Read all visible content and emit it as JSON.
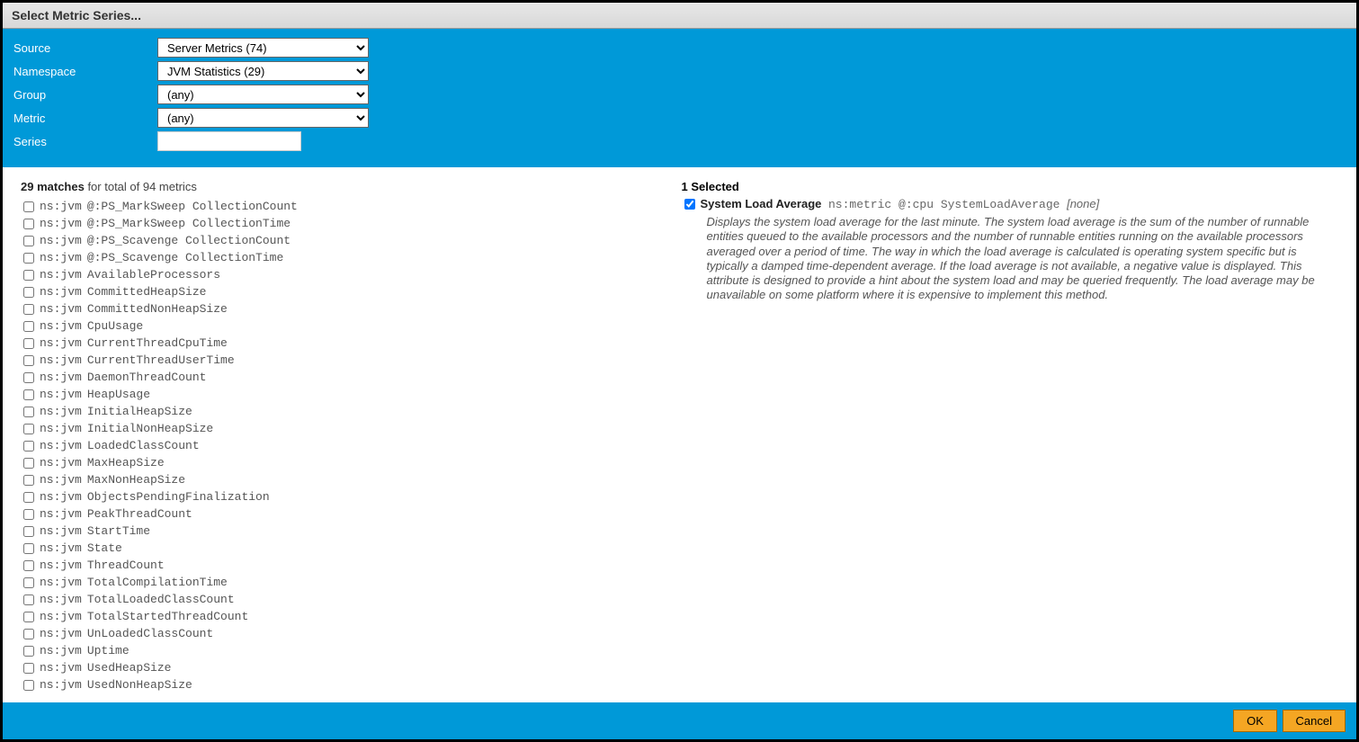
{
  "title": "Select Metric Series...",
  "form": {
    "source": {
      "label": "Source",
      "value": "Server Metrics (74)"
    },
    "namespace": {
      "label": "Namespace",
      "value": "JVM Statistics (29)"
    },
    "group": {
      "label": "Group",
      "value": "(any)"
    },
    "metric": {
      "label": "Metric",
      "value": "(any)"
    },
    "series": {
      "label": "Series",
      "value": ""
    }
  },
  "matches": {
    "count_text": "29 matches",
    "total_text": " for total of 94 metrics",
    "items": [
      {
        "ns": "ns:jvm",
        "name": "@:PS_MarkSweep CollectionCount"
      },
      {
        "ns": "ns:jvm",
        "name": "@:PS_MarkSweep CollectionTime"
      },
      {
        "ns": "ns:jvm",
        "name": "@:PS_Scavenge CollectionCount"
      },
      {
        "ns": "ns:jvm",
        "name": "@:PS_Scavenge CollectionTime"
      },
      {
        "ns": "ns:jvm",
        "name": "AvailableProcessors"
      },
      {
        "ns": "ns:jvm",
        "name": "CommittedHeapSize"
      },
      {
        "ns": "ns:jvm",
        "name": "CommittedNonHeapSize"
      },
      {
        "ns": "ns:jvm",
        "name": "CpuUsage"
      },
      {
        "ns": "ns:jvm",
        "name": "CurrentThreadCpuTime"
      },
      {
        "ns": "ns:jvm",
        "name": "CurrentThreadUserTime"
      },
      {
        "ns": "ns:jvm",
        "name": "DaemonThreadCount"
      },
      {
        "ns": "ns:jvm",
        "name": "HeapUsage"
      },
      {
        "ns": "ns:jvm",
        "name": "InitialHeapSize"
      },
      {
        "ns": "ns:jvm",
        "name": "InitialNonHeapSize"
      },
      {
        "ns": "ns:jvm",
        "name": "LoadedClassCount"
      },
      {
        "ns": "ns:jvm",
        "name": "MaxHeapSize"
      },
      {
        "ns": "ns:jvm",
        "name": "MaxNonHeapSize"
      },
      {
        "ns": "ns:jvm",
        "name": "ObjectsPendingFinalization"
      },
      {
        "ns": "ns:jvm",
        "name": "PeakThreadCount"
      },
      {
        "ns": "ns:jvm",
        "name": "StartTime"
      },
      {
        "ns": "ns:jvm",
        "name": "State"
      },
      {
        "ns": "ns:jvm",
        "name": "ThreadCount"
      },
      {
        "ns": "ns:jvm",
        "name": "TotalCompilationTime"
      },
      {
        "ns": "ns:jvm",
        "name": "TotalLoadedClassCount"
      },
      {
        "ns": "ns:jvm",
        "name": "TotalStartedThreadCount"
      },
      {
        "ns": "ns:jvm",
        "name": "UnLoadedClassCount"
      },
      {
        "ns": "ns:jvm",
        "name": "Uptime"
      },
      {
        "ns": "ns:jvm",
        "name": "UsedHeapSize"
      },
      {
        "ns": "ns:jvm",
        "name": "UsedNonHeapSize"
      }
    ]
  },
  "selected": {
    "header": "1 Selected",
    "item": {
      "title": "System Load Average",
      "meta": "ns:metric @:cpu SystemLoadAverage",
      "none": "[none]",
      "description": "Displays the system load average for the last minute. The system load average is the sum of the number of runnable entities queued to the available processors and the number of runnable entities running on the available processors averaged over a period of time. The way in which the load average is calculated is operating system specific but is typically a damped time-dependent average. If the load average is not available, a negative value is displayed. This attribute is designed to provide a hint about the system load and may be queried frequently. The load average may be unavailable on some platform where it is expensive to implement this method."
    }
  },
  "footer": {
    "ok": "OK",
    "cancel": "Cancel"
  }
}
